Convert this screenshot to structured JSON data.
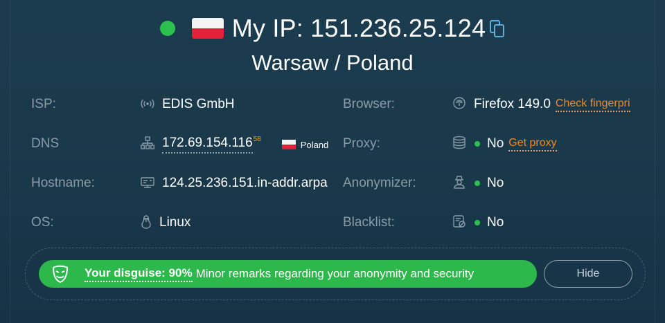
{
  "header": {
    "ip_title": "My IP: 151.236.25.124",
    "location": "Warsaw / Poland"
  },
  "rows": {
    "isp": {
      "label": "ISP:",
      "value": "EDIS GmbH",
      "icon": "signal-icon"
    },
    "dns": {
      "label": "DNS",
      "value": "172.69.154.116",
      "sup": "58",
      "country": "Poland",
      "icon": "network-icon"
    },
    "hostname": {
      "label": "Hostname:",
      "value": "124.25.236.151.in-addr.arpa",
      "icon": "server-icon"
    },
    "os": {
      "label": "OS:",
      "value": "Linux",
      "icon": "linux-icon"
    },
    "browser": {
      "label": "Browser:",
      "value": "Firefox 149.0",
      "link": "Check fingerpri",
      "icon": "fingerprint-icon"
    },
    "proxy": {
      "label": "Proxy:",
      "value": "No",
      "link": "Get proxy",
      "icon": "database-icon"
    },
    "anonymizer": {
      "label": "Anonymizer:",
      "value": "No",
      "icon": "spy-icon"
    },
    "blacklist": {
      "label": "Blacklist:",
      "value": "No",
      "icon": "blacklist-icon"
    }
  },
  "disguise": {
    "strong": "Your disguise: 90%",
    "text": "Minor remarks regarding your anonymity and security",
    "hide_label": "Hide"
  },
  "colors": {
    "accent_green": "#2cc14e",
    "link_orange": "#f08a24",
    "background": "#1b3b4e"
  }
}
